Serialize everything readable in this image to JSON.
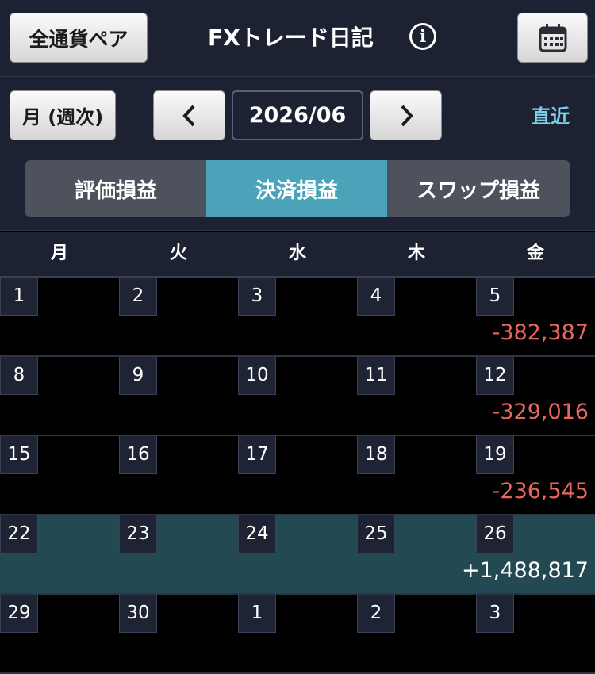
{
  "header": {
    "pair_button": "全通貨ペア",
    "title": "FXトレード日記",
    "info_glyph": "i"
  },
  "nav": {
    "period_button": "月 (週次)",
    "prev_glyph": "<",
    "date": "2026/06",
    "next_glyph": ">",
    "latest": "直近"
  },
  "tabs": [
    {
      "label": "評価損益",
      "active": false
    },
    {
      "label": "決済損益",
      "active": true
    },
    {
      "label": "スワップ損益",
      "active": false
    }
  ],
  "weekdays": [
    "月",
    "火",
    "水",
    "木",
    "金"
  ],
  "weeks": [
    {
      "days": [
        "1",
        "2",
        "3",
        "4",
        "5"
      ],
      "pl": "-382,387",
      "sign": "neg"
    },
    {
      "days": [
        "8",
        "9",
        "10",
        "11",
        "12"
      ],
      "pl": "-329,016",
      "sign": "neg"
    },
    {
      "days": [
        "15",
        "16",
        "17",
        "18",
        "19"
      ],
      "pl": "-236,545",
      "sign": "neg"
    },
    {
      "days": [
        "22",
        "23",
        "24",
        "25",
        "26"
      ],
      "pl": "+1,488,817",
      "sign": "pos"
    },
    {
      "days": [
        "29",
        "30",
        "1",
        "2",
        "3"
      ],
      "pl": "",
      "sign": ""
    }
  ],
  "colors": {
    "accent": "#4aa3b8",
    "negative": "#e8685f",
    "link": "#7fd0ec",
    "highlight_row": "#234a52"
  }
}
